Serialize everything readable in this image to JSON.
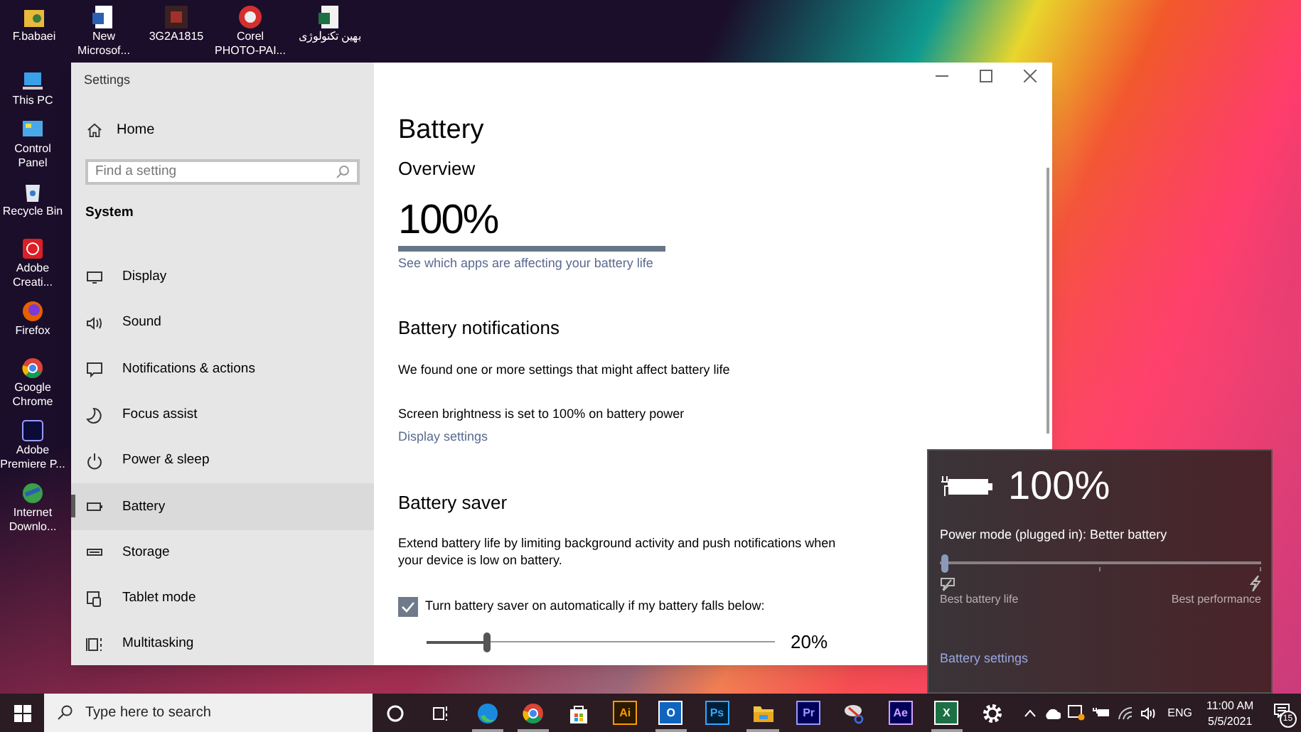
{
  "desktop": {
    "top_icons": [
      {
        "label": "F.babaei"
      },
      {
        "label": "New Microsof..."
      },
      {
        "label": "3G2A1815"
      },
      {
        "label": "Corel PHOTO-PAI..."
      },
      {
        "label": "بهین تکنولوژی"
      }
    ],
    "side_icons": [
      {
        "label": "This PC"
      },
      {
        "label": "Control Panel"
      },
      {
        "label": "Recycle Bin"
      },
      {
        "label": "Adobe Creati..."
      },
      {
        "label": "Firefox"
      },
      {
        "label": "Google Chrome"
      },
      {
        "label": "Adobe Premiere P..."
      },
      {
        "label": "Internet Downlo..."
      }
    ]
  },
  "settings_window": {
    "title": "Settings",
    "sidebar": {
      "home": "Home",
      "search": {
        "placeholder": "Find a setting"
      },
      "section": "System",
      "items": [
        {
          "label": "Display",
          "selected": false
        },
        {
          "label": "Sound",
          "selected": false
        },
        {
          "label": "Notifications & actions",
          "selected": false
        },
        {
          "label": "Focus assist",
          "selected": false
        },
        {
          "label": "Power & sleep",
          "selected": false
        },
        {
          "label": "Battery",
          "selected": true
        },
        {
          "label": "Storage",
          "selected": false
        },
        {
          "label": "Tablet mode",
          "selected": false
        },
        {
          "label": "Multitasking",
          "selected": false
        }
      ]
    },
    "content": {
      "heading": "Battery",
      "overview": {
        "heading": "Overview",
        "percent": "100%",
        "level": 1,
        "link": "See which apps are affecting your battery life"
      },
      "notifications": {
        "heading": "Battery notifications",
        "text": "We found one or more settings that might affect battery life",
        "detail": "Screen brightness is set to 100% on battery power",
        "link": "Display settings"
      },
      "saver": {
        "heading": "Battery saver",
        "description": "Extend battery life by limiting background activity and push notifications when your device is low on battery.",
        "checkbox": {
          "label": "Turn battery saver on automatically if my battery falls below:",
          "checked": true
        },
        "slider": {
          "level": 0.17,
          "reading": "20%"
        }
      }
    }
  },
  "battery_flyout": {
    "percent": "100%",
    "power_mode": "Power mode (plugged in): Better battery",
    "slider": {
      "level": 0
    },
    "left_label": "Best battery life",
    "right_label": "Best performance",
    "link": "Battery settings"
  },
  "taskbar": {
    "search": {
      "placeholder": "Type here to search"
    },
    "apps": [
      {
        "running": false
      },
      {
        "running": false
      },
      {
        "running": true
      },
      {
        "running": true
      },
      {
        "running": false
      },
      {
        "text": "Ai",
        "running": false
      },
      {
        "text": "O",
        "running": true
      },
      {
        "text": "Ps",
        "running": false
      },
      {
        "running": true
      },
      {
        "text": "Pr",
        "running": false
      },
      {
        "running": false
      },
      {
        "text": "Ae",
        "running": false
      },
      {
        "text": "X",
        "running": true
      },
      {
        "running": false
      }
    ],
    "language": "ENG",
    "time": "11:00 AM",
    "date": "5/5/2021",
    "notification_count": "15"
  }
}
